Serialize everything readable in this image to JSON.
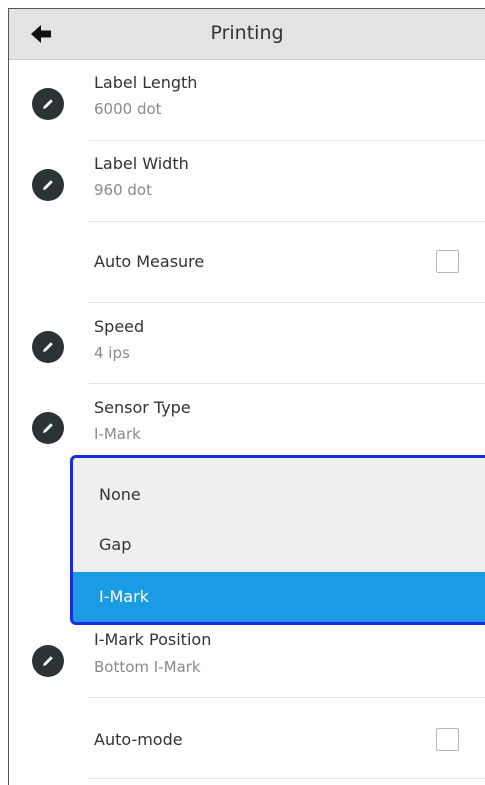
{
  "header": {
    "title": "Printing"
  },
  "rows": [
    {
      "title": "Label Length",
      "value": "6000 dot"
    },
    {
      "title": "Label Width",
      "value": "960 dot"
    },
    {
      "title": "Auto Measure",
      "checked": false
    },
    {
      "title": "Speed",
      "value": "4 ips"
    },
    {
      "title": "Sensor Type",
      "value": "I-Mark"
    },
    {
      "title": "I-Mark Position",
      "value": "Bottom I-Mark"
    },
    {
      "title": "Auto-mode",
      "checked": false
    }
  ],
  "sensor_dropdown": {
    "options": [
      "None",
      "Gap",
      "I-Mark"
    ],
    "selected": "I-Mark"
  },
  "colors": {
    "header_bg": "#e3e3e3",
    "icon_bg": "#2b3335",
    "dropdown_border": "#1a2bdb",
    "selected_bg": "#1a9be3"
  },
  "icons": {
    "back": "arrow-left-icon",
    "edit": "pencil-icon"
  }
}
